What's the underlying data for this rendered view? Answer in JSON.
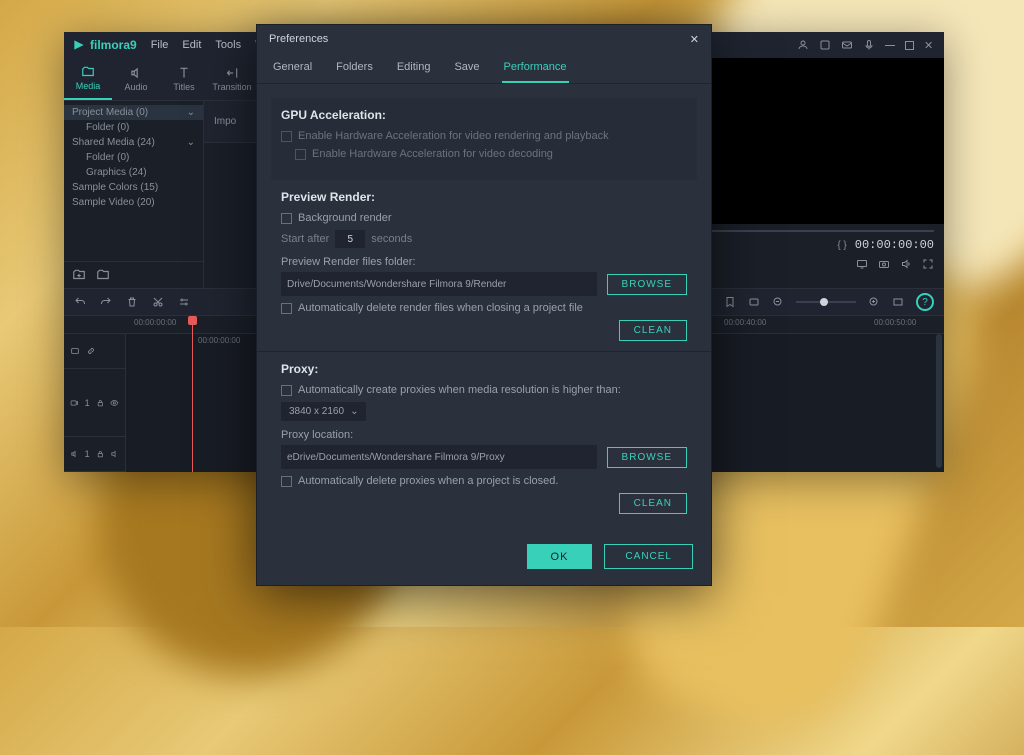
{
  "app": {
    "name": "filmora9",
    "menus": [
      "File",
      "Edit",
      "Tools",
      "View"
    ]
  },
  "tabs": {
    "items": [
      {
        "label": "Media",
        "active": true
      },
      {
        "label": "Audio"
      },
      {
        "label": "Titles"
      },
      {
        "label": "Transition"
      }
    ]
  },
  "tree": {
    "items": [
      {
        "label": "Project Media (0)",
        "indent": 0,
        "sel": true,
        "chev": true
      },
      {
        "label": "Folder (0)",
        "indent": 1
      },
      {
        "label": "Shared Media (24)",
        "indent": 0,
        "chev": true
      },
      {
        "label": "Folder (0)",
        "indent": 1
      },
      {
        "label": "Graphics (24)",
        "indent": 1
      },
      {
        "label": "Sample Colors (15)",
        "indent": 0
      },
      {
        "label": "Sample Video (20)",
        "indent": 0
      }
    ]
  },
  "import_area_label": "Impo",
  "preview": {
    "markers": "{ }",
    "timecode": "00:00:00:00"
  },
  "timeline": {
    "ruler": [
      "00:00:00:00",
      "00:00:40:00",
      "00:00:50:00"
    ],
    "small_ruler": "00:00:00:00",
    "track1": "1",
    "track2": "1"
  },
  "preferences": {
    "title": "Preferences",
    "tabs": [
      "General",
      "Folders",
      "Editing",
      "Save",
      "Performance"
    ],
    "active_tab": "Performance",
    "gpu": {
      "title": "GPU Acceleration:",
      "opt1": "Enable Hardware Acceleration for video rendering and playback",
      "opt2": "Enable Hardware Acceleration for video decoding"
    },
    "preview": {
      "title": "Preview Render:",
      "bg_render": "Background render",
      "start_after_prefix": "Start after",
      "start_after_value": "5",
      "start_after_suffix": "seconds",
      "folder_label": "Preview Render files folder:",
      "folder_value": "Drive/Documents/Wondershare Filmora 9/Render",
      "browse": "BROWSE",
      "auto_delete": "Automatically delete render files when closing a project file",
      "clean": "CLEAN"
    },
    "proxy": {
      "title": "Proxy:",
      "auto_create": "Automatically create proxies when media resolution is higher than:",
      "resolution": "3840 x 2160",
      "location_label": "Proxy location:",
      "location_value": "eDrive/Documents/Wondershare Filmora 9/Proxy",
      "browse": "BROWSE",
      "auto_delete": "Automatically delete proxies when a project is closed.",
      "clean": "CLEAN"
    },
    "ok": "OK",
    "cancel": "CANCEL"
  }
}
